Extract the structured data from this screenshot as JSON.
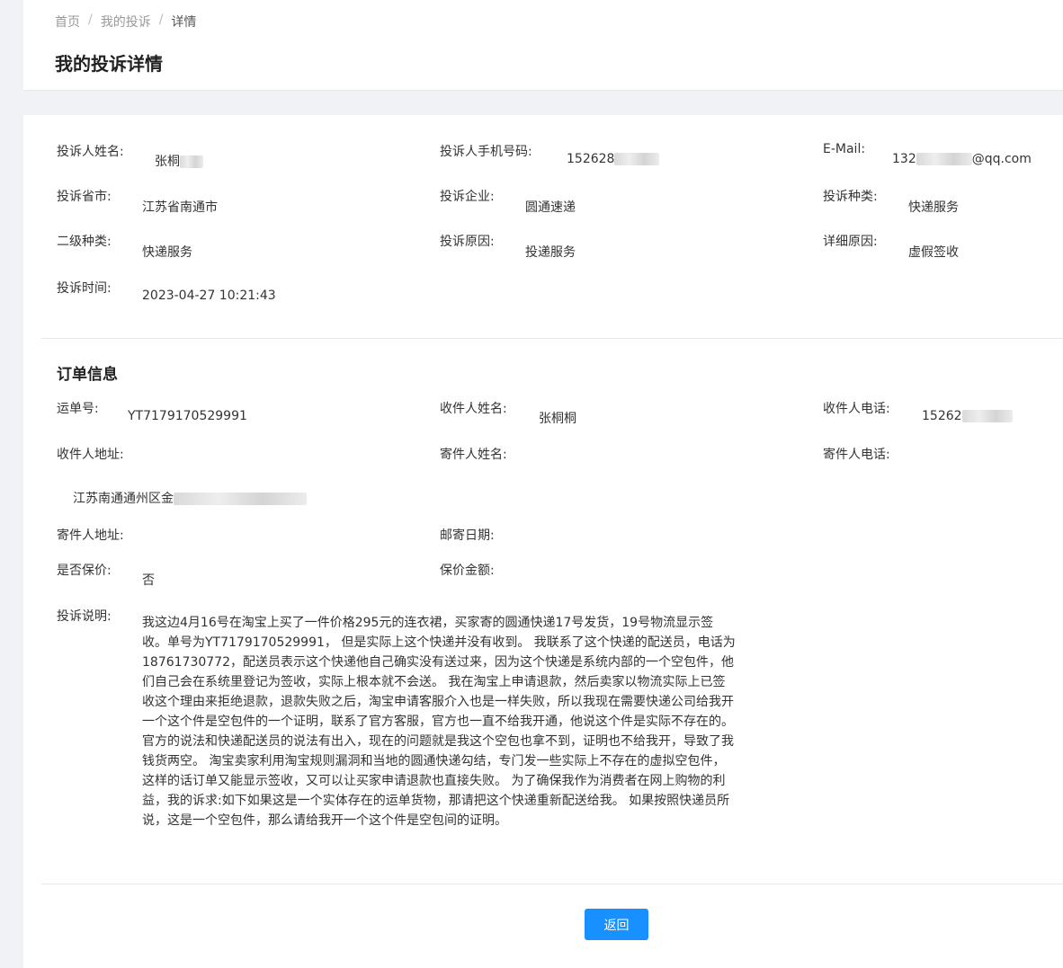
{
  "breadcrumb": {
    "home": "首页",
    "sep": "/",
    "list": "我的投诉",
    "current": "详情"
  },
  "page_title": "我的投诉详情",
  "complaint": {
    "name_label": "投诉人姓名:",
    "name_value": "张桐",
    "phone_label": "投诉人手机号码:",
    "phone_value": "152628",
    "email_label": "E-Mail:",
    "email_prefix": "132",
    "email_suffix": "@qq.com",
    "province_label": "投诉省市:",
    "province_value": "江苏省南通市",
    "company_label": "投诉企业:",
    "company_value": "圆通速递",
    "type_label": "投诉种类:",
    "type_value": "快递服务",
    "subtype_label": "二级种类:",
    "subtype_value": "快递服务",
    "reason_label": "投诉原因:",
    "reason_value": "投递服务",
    "detail_label": "详细原因:",
    "detail_value": "虚假签收",
    "time_label": "投诉时间:",
    "time_value": "2023-04-27 10:21:43"
  },
  "order": {
    "section_title": "订单信息",
    "waybill_label": "运单号:",
    "waybill_value": "YT7179170529991",
    "receiver_name_label": "收件人姓名:",
    "receiver_name_value": "张桐桐",
    "receiver_phone_label": "收件人电话:",
    "receiver_phone_value": "15262",
    "receiver_addr_label": "收件人地址:",
    "receiver_addr_value": "江苏南通通州区金",
    "sender_name_label": "寄件人姓名:",
    "sender_phone_label": "寄件人电话:",
    "sender_addr_label": "寄件人地址:",
    "mail_date_label": "邮寄日期:",
    "insured_label": "是否保价:",
    "insured_value": "否",
    "insured_amount_label": "保价金额:",
    "desc_label": "投诉说明:",
    "desc_value": "我这边4月16号在淘宝上买了一件价格295元的连衣裙，买家寄的圆通快递17号发货，19号物流显示签收。单号为YT7179170529991， 但是实际上这个快递并没有收到。 我联系了这个快递的配送员，电话为18761730772，配送员表示这个快递他自己确实没有送过来，因为这个快递是系统内部的一个空包件，他们自己会在系统里登记为签收，实际上根本就不会送。 我在淘宝上申请退款，然后卖家以物流实际上已签收这个理由来拒绝退款，退款失败之后，淘宝申请客服介入也是一样失败，所以我现在需要快递公司给我开一个这个件是空包件的一个证明，联系了官方客服，官方也一直不给我开通，他说这个件是实际不存在的。 官方的说法和快递配送员的说法有出入，现在的问题就是我这个空包也拿不到，证明也不给我开，导致了我钱货两空。 淘宝卖家利用淘宝规则漏洞和当地的圆通快递勾结，专门发一些实际上不存在的虚拟空包件，这样的话订单又能显示签收，又可以让买家申请退款也直接失败。 为了确保我作为消费者在网上购物的利益，我的诉求:如下如果这是一个实体存在的运单货物，那请把这个快递重新配送给我。 如果按照快递员所说，这是一个空包件，那么请给我开一个这个件是空包间的证明。"
  },
  "actions": {
    "back_label": "返回"
  },
  "colors": {
    "primary": "#1890ff",
    "background": "#f0f2f5"
  }
}
